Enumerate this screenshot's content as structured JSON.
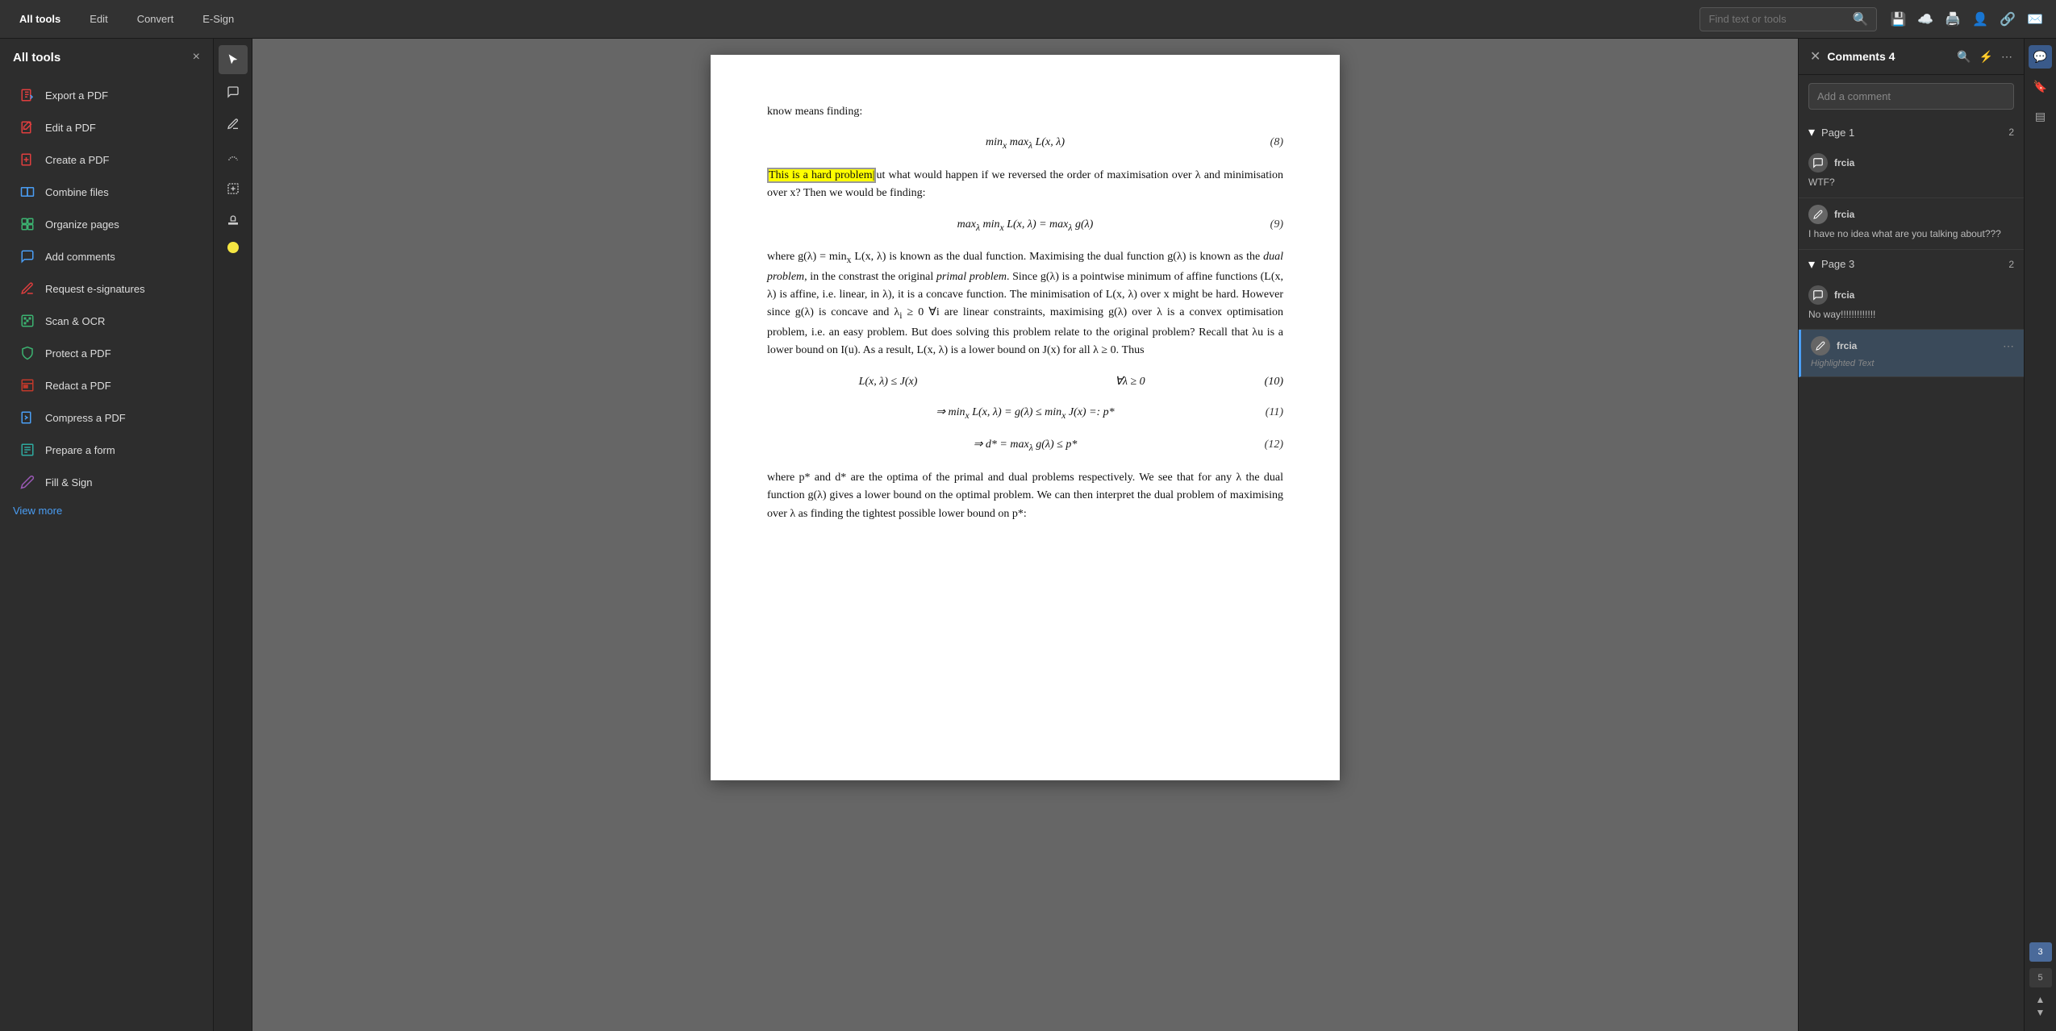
{
  "topbar": {
    "nav_items": [
      {
        "label": "All tools",
        "active": true
      },
      {
        "label": "Edit",
        "active": false
      },
      {
        "label": "Convert",
        "active": false
      },
      {
        "label": "E-Sign",
        "active": false
      }
    ],
    "search_placeholder": "Find text or tools"
  },
  "sidebar": {
    "title": "All tools",
    "close_label": "×",
    "items": [
      {
        "label": "Export a PDF",
        "icon": "📄",
        "color": "icon-red"
      },
      {
        "label": "Edit a PDF",
        "icon": "✏️",
        "color": "icon-red"
      },
      {
        "label": "Create a PDF",
        "icon": "📋",
        "color": "icon-red"
      },
      {
        "label": "Combine files",
        "icon": "🗂️",
        "color": "icon-blue"
      },
      {
        "label": "Organize pages",
        "icon": "📑",
        "color": "icon-green"
      },
      {
        "label": "Add comments",
        "icon": "💬",
        "color": "icon-blue"
      },
      {
        "label": "Request e-signatures",
        "icon": "✍️",
        "color": "icon-red"
      },
      {
        "label": "Scan & OCR",
        "icon": "🔍",
        "color": "icon-green"
      },
      {
        "label": "Protect a PDF",
        "icon": "🔒",
        "color": "icon-green"
      },
      {
        "label": "Redact a PDF",
        "icon": "⬛",
        "color": "icon-dark-red"
      },
      {
        "label": "Compress a PDF",
        "icon": "📦",
        "color": "icon-blue"
      },
      {
        "label": "Prepare a form",
        "icon": "📋",
        "color": "icon-teal"
      },
      {
        "label": "Fill & Sign",
        "icon": "✒️",
        "color": "icon-purple"
      }
    ],
    "view_more": "View more"
  },
  "comments": {
    "title": "Comments",
    "count": 4,
    "add_placeholder": "Add a comment",
    "pages": [
      {
        "page_label": "Page 1",
        "count": 2,
        "items": [
          {
            "user": "frcia",
            "type": "bubble",
            "text": "WTF?"
          },
          {
            "user": "frcia",
            "type": "pencil",
            "text": "I have no idea what are you talking about???"
          }
        ]
      },
      {
        "page_label": "Page 3",
        "count": 2,
        "items": [
          {
            "user": "frcia",
            "type": "bubble",
            "text": "No way!!!!!!!!!!!!!"
          },
          {
            "user": "frcia",
            "type": "pencil",
            "text": "Highlighted Text",
            "is_subtext": true,
            "highlighted": true
          }
        ]
      }
    ]
  },
  "pdf": {
    "content": {
      "intro": "know means finding:",
      "eq8": "min max L(x, λ)   (8)",
      "para1": "This is a hard problem, but what would happen if we reversed the order of maximisation over λ and minimisation over x? Then we would be finding:",
      "eq9": "max min L(x, λ) = max g(λ)   (9)",
      "para2": "where g(λ) = minₓ L(x, λ) is known as the dual function. Maximising the dual function g(λ) is known as the dual problem, in the constrast the original primal problem. Since g(λ) is a pointwise minimum of affine functions (L(x, λ) is affine, i.e. linear, in λ), it is a concave function. The minimisation of L(x, λ) over x might be hard. However since g(λ) is concave and λᵢ ≥ 0 ∀i are linear constraints, maximising g(λ) over λ is a convex optimisation problem, i.e. an easy problem. But does solving this problem relate to the original problem? Recall that λu is a lower bound on I(u). As a result, L(x, λ) is a lower bound on J(x) for all λ ≥ 0. Thus",
      "eq10": "L(x, λ) ≤ J(x)   ∀λ ≥ 0   (10)",
      "eq11": "⇒ min L(x, λ) = g(λ) ≤ min J(x) =: p*   (11)",
      "eq12": "⇒ d* = max g(λ) ≤ p*   (12)",
      "para3": "where p* and d* are the optima of the primal and dual problems respectively. We see that for any λ the dual function g(λ) gives a lower bound on the optimal problem. We can then interpret the dual problem of maximising over λ as finding the tightest possible lower bound on p*:"
    }
  },
  "far_right": {
    "page_badges": [
      "3",
      "5"
    ]
  }
}
